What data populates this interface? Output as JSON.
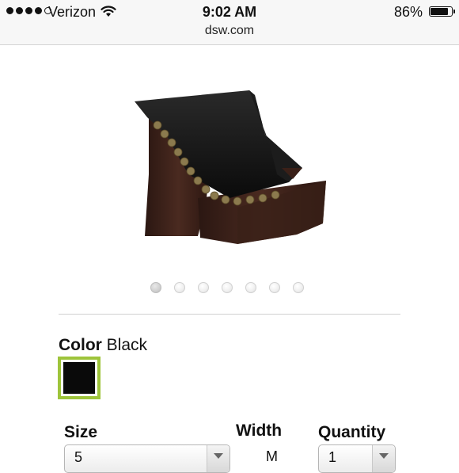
{
  "status_bar": {
    "carrier": "Verizon",
    "time": "9:02 AM",
    "battery_percent": "86%",
    "battery_level": 0.86,
    "url": "dsw.com"
  },
  "product": {
    "image_icon": "shoe-product-image",
    "carousel": {
      "total": 7,
      "active_index": 0
    }
  },
  "color": {
    "label": "Color",
    "value": "Black",
    "swatch_color": "#0a0a0a",
    "selected_border_color": "#9ec43b"
  },
  "size": {
    "label": "Size",
    "value": "5"
  },
  "width": {
    "label": "Width",
    "value": "M"
  },
  "quantity": {
    "label": "Quantity",
    "value": "1"
  }
}
